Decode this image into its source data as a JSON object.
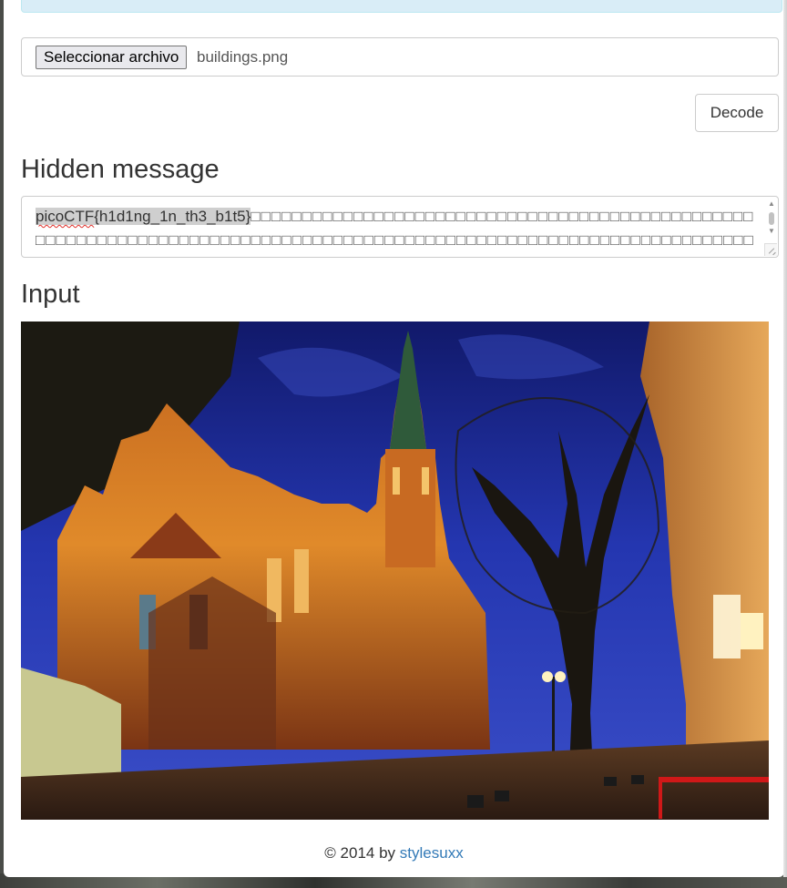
{
  "upload": {
    "button_label": "Seleccionar archivo",
    "file_name": "buildings.png"
  },
  "decode_button": "Decode",
  "hidden_message": {
    "title": "Hidden message",
    "flag_prefix": "picoCTF",
    "flag_rest": "{h1d1ng_1n_th3_b1t5}",
    "trailing_boxes": "□□□□□□□□□□□□□□□□□□□□□□□□□□□□□□□□□□□□□□□□□□□□□□□□□□□□□□□□□□□□□□□□□□□□□□□□□□□□□□□□□□□□□□□□□□□□□□□□□□□□□□□□□□□□□□□□□□□□□□□□□□□□□□□□□□□□□□□□□□□□□□□□□□□□□□□□□□□□□□□□□□□□"
  },
  "input_section": {
    "title": "Input",
    "image_subject": "illuminated gothic church on a city street at dusk"
  },
  "footer": {
    "copyright": "© 2014 by",
    "link_text": "stylesuxx"
  },
  "colors": {
    "link": "#337ab7",
    "sky": "#1f2f9a",
    "church_light": "#e08a2a"
  }
}
